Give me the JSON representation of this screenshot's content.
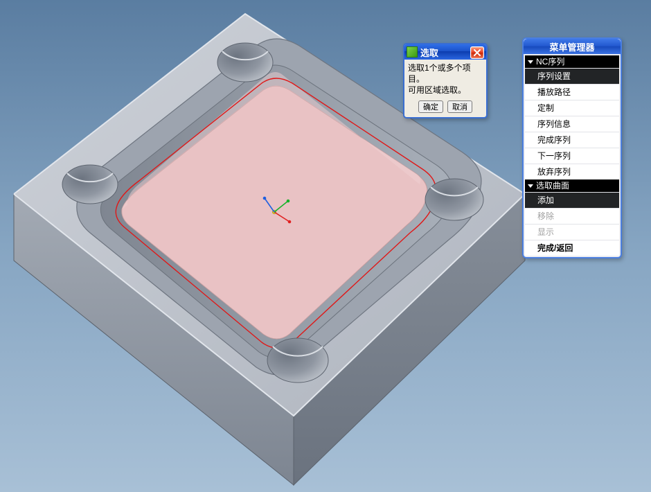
{
  "select_dialog": {
    "title": "选取",
    "message_line1": "选取1个或多个项目。",
    "message_line2": "可用区域选取。",
    "ok_label": "确定",
    "cancel_label": "取消"
  },
  "menu_manager": {
    "title": "菜单管理器",
    "section1": {
      "label": "NC序列",
      "items": [
        {
          "label": "序列设置",
          "selected": true
        },
        {
          "label": "播放路径"
        },
        {
          "label": "定制"
        },
        {
          "label": "序列信息"
        },
        {
          "label": "完成序列"
        },
        {
          "label": "下一序列"
        },
        {
          "label": "放弃序列"
        }
      ]
    },
    "section2": {
      "label": "选取曲面",
      "items": [
        {
          "label": "添加",
          "selected": true
        },
        {
          "label": "移除",
          "disabled": true
        },
        {
          "label": "显示",
          "disabled": true
        },
        {
          "label": "完成/返回",
          "bold": true
        }
      ]
    }
  },
  "model": {
    "selected_surface": "pocket-floor",
    "csys_axes": [
      "X",
      "Y",
      "Z"
    ],
    "colors": {
      "part": "#b7bdc6",
      "part_dark": "#8f97a2",
      "part_light": "#d3d7dd",
      "pocket_floor_selected": "#e7bcbf",
      "selection_outline": "#e11"
    }
  }
}
